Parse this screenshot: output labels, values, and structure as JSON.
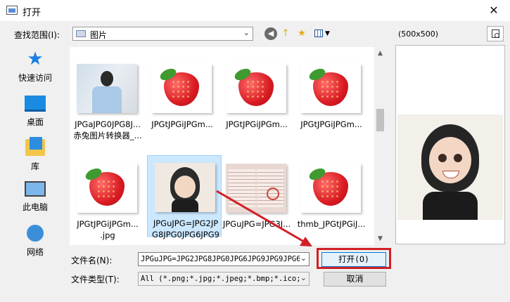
{
  "window": {
    "title": "打开",
    "close_glyph": "✕"
  },
  "lookin": {
    "label": "查找范围(I):",
    "value": "图片"
  },
  "toolbar": {
    "back": "◀",
    "up": "↑",
    "newfolder": "★"
  },
  "places": [
    {
      "label": "快速访问",
      "icon": "star-icon"
    },
    {
      "label": "桌面",
      "icon": "desktop-icon"
    },
    {
      "label": "库",
      "icon": "library-icon"
    },
    {
      "label": "此电脑",
      "icon": "computer-icon"
    },
    {
      "label": "网络",
      "icon": "network-icon"
    }
  ],
  "files": [
    {
      "caption": "JPGaJPG0JPG8J...\n赤兔图片转换器_...",
      "kind": "person"
    },
    {
      "caption": "JPGtJPGiJPGm...",
      "kind": "strawberry"
    },
    {
      "caption": "JPGtJPGiJPGm...",
      "kind": "strawberry"
    },
    {
      "caption": "JPGtJPGiJPGm...",
      "kind": "strawberry"
    },
    {
      "caption": "JPGtJPGiJPGm...\n.jpg",
      "kind": "strawberry"
    },
    {
      "caption": "JPGuJPG=JPG2JP\nG8JPG0JPG6JPG9",
      "kind": "girl",
      "selected": true
    },
    {
      "caption": "JPGuJPG=JPG3J...",
      "kind": "document"
    },
    {
      "caption": "thmb_JPGtJPGiJ...",
      "kind": "strawberry"
    }
  ],
  "filename": {
    "label": "文件名(N):",
    "value": "JPGuJPG=JPG2JPG8JPG0JPG6JPG9JPG9JPG6J"
  },
  "filetype": {
    "label": "文件类型(T):",
    "value": "All (*.png;*.jpg;*.jpeg;*.bmp;*.ico;*"
  },
  "buttons": {
    "open": "打开(O)",
    "cancel": "取消"
  },
  "preview": {
    "size": "(500x500)"
  },
  "colors": {
    "highlight": "#d21f26",
    "accent": "#0078d7"
  }
}
